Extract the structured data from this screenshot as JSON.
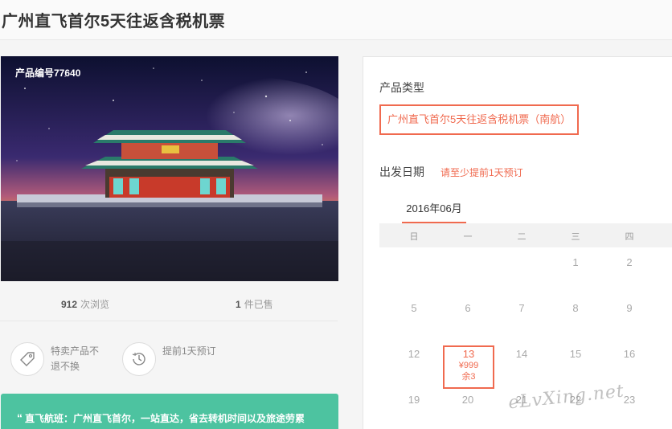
{
  "page": {
    "title": "广州直飞首尔5天往返含税机票"
  },
  "hero": {
    "product_code": "产品编号77640"
  },
  "stats": {
    "views_num": "912",
    "views_label": "次浏览",
    "sold_num": "1",
    "sold_label": "件已售"
  },
  "features": [
    {
      "icon": "tag-icon",
      "text": "特卖产品不退不换"
    },
    {
      "icon": "clock-icon",
      "text": "提前1天预订"
    }
  ],
  "promo": {
    "quote": "“",
    "text": "直飞航班：广州直飞首尔，一站直达，省去转机时间以及旅途劳累"
  },
  "booking": {
    "type_label": "产品类型",
    "type_option": "广州直飞首尔5天往返含税机票（南航）",
    "date_label": "出发日期",
    "date_note": "请至少提前1天预订",
    "month_tab": "2016年06月",
    "weekdays": [
      "日",
      "一",
      "二",
      "三",
      "四"
    ],
    "days_row1": [
      "1",
      "2"
    ],
    "days_row2": [
      "5",
      "6",
      "7",
      "8",
      "9"
    ],
    "days_row3": [
      "12",
      "14",
      "15",
      "16"
    ],
    "days_row4": [
      "19",
      "20",
      "21",
      "22",
      "23"
    ],
    "selected_day": {
      "day": "13",
      "price": "¥999",
      "remaining": "余3"
    }
  },
  "colors": {
    "accent": "#f06a4f",
    "promo": "#4dc3a0"
  },
  "watermark": "eLvXing.net"
}
